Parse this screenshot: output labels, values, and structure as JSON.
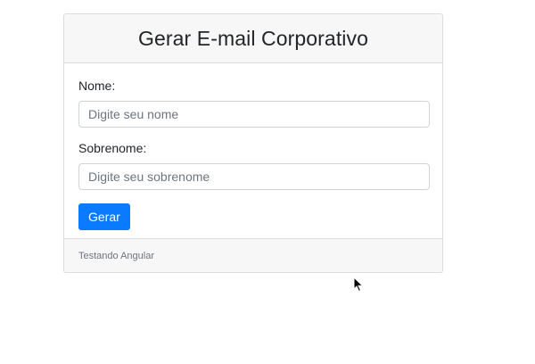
{
  "card": {
    "title": "Gerar E-mail Corporativo",
    "fields": {
      "nome": {
        "label": "Nome:",
        "placeholder": "Digite seu nome",
        "value": ""
      },
      "sobrenome": {
        "label": "Sobrenome:",
        "placeholder": "Digite seu sobrenome",
        "value": ""
      }
    },
    "submit_label": "Gerar",
    "footer_text": "Testando Angular"
  },
  "colors": {
    "primary": "#0a7bff",
    "header_bg": "#f7f7f7",
    "border": "#dcdcdc"
  },
  "icons": {
    "cursor": "mouse-pointer-icon"
  }
}
